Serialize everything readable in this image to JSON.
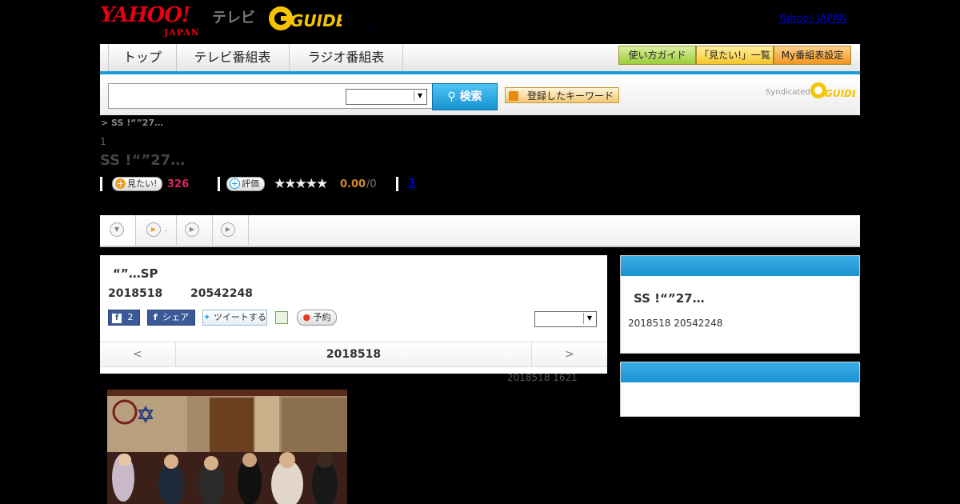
{
  "header": {
    "yahoo_logo": "YAHOO!",
    "yahoo_logo_sub": "JAPAN",
    "tv_label": "テレビ",
    "gguide_logo": "GUIDE",
    "yahoo_japan_link": "Yahoo! JAPAN",
    "dot1": ",",
    "dot2": ","
  },
  "nav": {
    "tabs": [
      {
        "label": "トップ"
      },
      {
        "label": "テレビ番組表"
      },
      {
        "label": "ラジオ番組表"
      }
    ],
    "right_buttons": [
      {
        "label": "使い方ガイド",
        "color": "#b7e05a"
      },
      {
        "label": "「見たい!」一覧",
        "color": "#ffd34a"
      },
      {
        "label": "My番組表設定",
        "color": "#f7a634"
      }
    ]
  },
  "search": {
    "input_value": "",
    "select_value": "",
    "button_label": "検索",
    "keyword_button": "登録したキーワード",
    "syndicated_label": "Syndicated",
    "syndicated_logo": "GUIDE"
  },
  "program": {
    "breadcrumb": "> SS !“”27…",
    "channel_num": "1",
    "title": "SS !“”27…",
    "mitai_label": "見たい!",
    "mitai_count": "326",
    "rating_label": "評価",
    "stars": "★★★★★",
    "score": "0.00",
    "score_sub": "/0",
    "link_count": "3"
  },
  "tabstrip": {
    "tab2_text": "."
  },
  "episode": {
    "title": "“”…SP",
    "date": "2018518",
    "time": "20542248",
    "fb_like_count": "2",
    "fb_share_label": "シェア",
    "tweet_label": "ツイートする",
    "reserve_label": "予約",
    "select_value": "",
    "nav_prev": "<",
    "nav_date": "2018518",
    "nav_next": ">",
    "updated": "2018518  1621"
  },
  "side": {
    "title": "SS !“”27…",
    "date": "2018518  20542248"
  },
  "colors": {
    "accent_blue": "#1a9bd7",
    "yahoo_red": "#e60012",
    "mitai_pink": "#e0245e",
    "score_orange": "#d78a2a",
    "facebook": "#3b5998"
  }
}
